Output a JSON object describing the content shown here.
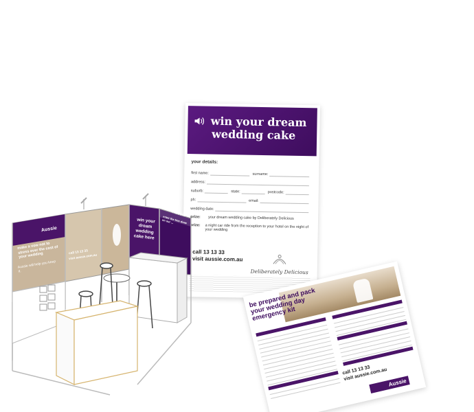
{
  "flyer": {
    "title_line1": "win your dream",
    "title_line2": "wedding cake",
    "details_heading": "your details:",
    "fields": {
      "first_name": "first name:",
      "surname": "surname:",
      "address": "address:",
      "suburb": "suburb:",
      "state": "state:",
      "postcode": "postcode:",
      "ph": "ph:",
      "email": "email:",
      "wedding_date": "wedding date:"
    },
    "prize_label": "prize:",
    "prize_text": "your dream wedding cake by Deliberately Delicious",
    "second_prize_label": "prize:",
    "second_prize_text": "a night car ride from the reception to your hotel on the night of your wedding",
    "call": "call 13 13 33",
    "visit": "visit aussie.com.au",
    "sponsor_name": "Deliberately Delicious"
  },
  "sheet": {
    "title": "be prepared and pack your wedding day emergency kit",
    "call": "call 13 13 33",
    "visit": "visit aussie.com.au",
    "logo": "Aussie"
  },
  "booth": {
    "logo": "Aussie",
    "panel1_heading": "make a vow not to stress over the cost of your wedding",
    "panel1_sub": "Aussie will help you keep it.",
    "panel4_text": "win your dream wedding cake here",
    "panel5_heading": "enter the free draw on our ...",
    "panel6_logo": "Aussie",
    "panel2_call": "call 13 13 33",
    "panel2_visit": "visit aussie.com.au"
  },
  "colors": {
    "brand_purple": "#4a1468",
    "brand_purple_dark": "#3e0d5e"
  }
}
